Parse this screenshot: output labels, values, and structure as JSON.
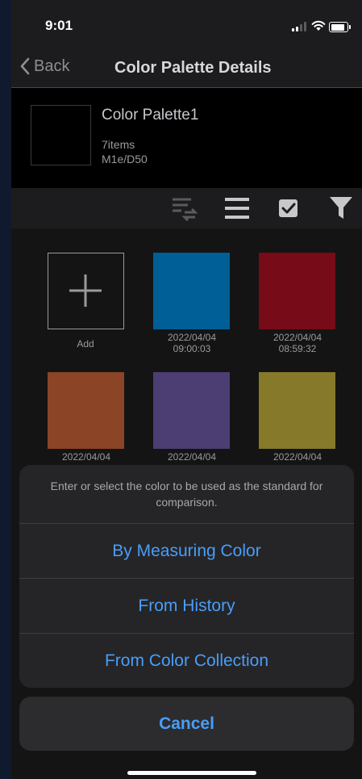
{
  "status_bar": {
    "time": "9:01"
  },
  "nav": {
    "back_label": "Back",
    "title": "Color Palette Details"
  },
  "palette": {
    "name": "Color Palette1",
    "count": "7items",
    "condition": "M1e/D50"
  },
  "grid": {
    "add_label": "Add",
    "items": [
      {
        "color": "#005f97",
        "date": "2022/04/04",
        "time": "09:00:03"
      },
      {
        "color": "#770b17",
        "date": "2022/04/04",
        "time": "08:59:32"
      },
      {
        "color": "#8b4426",
        "date": "2022/04/04",
        "time": ""
      },
      {
        "color": "#4c3d73",
        "date": "2022/04/04",
        "time": ""
      },
      {
        "color": "#87792a",
        "date": "2022/04/04",
        "time": ""
      }
    ]
  },
  "action_sheet": {
    "message": "Enter or select the color to be used as the standard for comparison.",
    "options": [
      "By Measuring Color",
      "From History",
      "From Color Collection"
    ],
    "cancel": "Cancel"
  },
  "colors": {
    "accent": "#4a9df8",
    "nav_border": "#2f4a78"
  },
  "icons": [
    "chevron-left-icon",
    "sort-swap-icon",
    "list-icon",
    "checkbox-icon",
    "filter-icon",
    "plus-icon"
  ]
}
